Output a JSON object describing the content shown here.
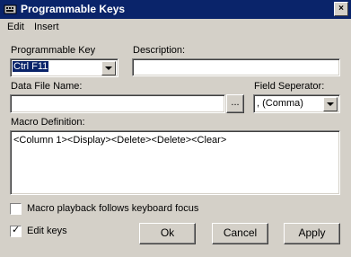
{
  "window": {
    "title": "Programmable Keys",
    "close_label": "×"
  },
  "menu": {
    "items": [
      "Edit",
      "Insert"
    ]
  },
  "programmable_key": {
    "label": "Programmable Key",
    "value": "Ctrl F11"
  },
  "description": {
    "label": "Description:",
    "value": ""
  },
  "data_file": {
    "label": "Data File Name:",
    "value": "",
    "browse_label": "..."
  },
  "field_separator": {
    "label": "Field Seperator:",
    "value": ", (Comma)"
  },
  "macro": {
    "label": "Macro Definition:",
    "value": "<Column 1><Display><Delete><Delete><Clear>"
  },
  "checkboxes": {
    "playback_focus": {
      "label": "Macro playback follows keyboard focus",
      "checked": false
    },
    "edit_keys": {
      "label": "Edit keys",
      "checked": true,
      "check_mark": "✓"
    }
  },
  "buttons": {
    "ok": "Ok",
    "cancel": "Cancel",
    "apply": "Apply"
  }
}
